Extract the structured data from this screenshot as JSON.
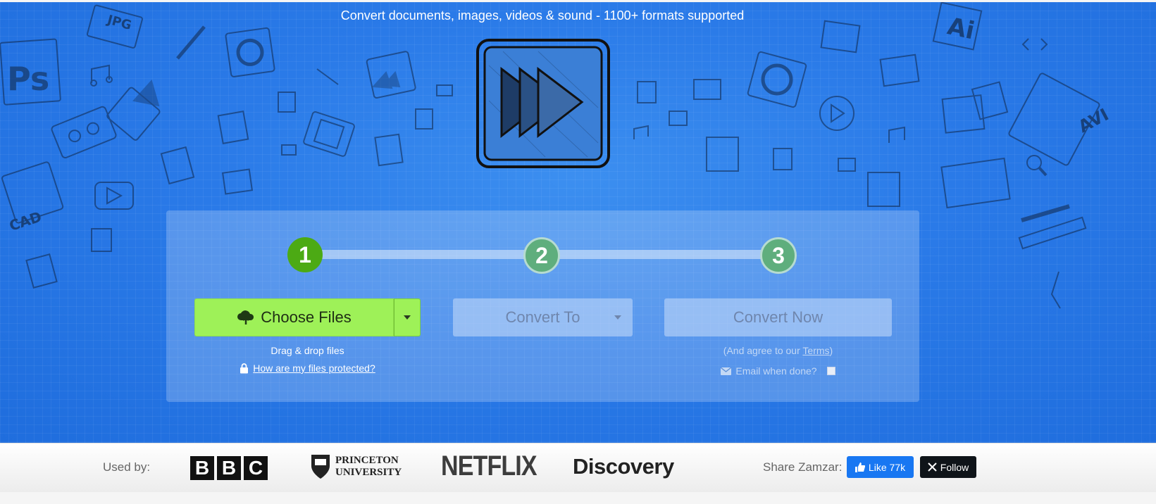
{
  "hero": {
    "tagline": "Convert documents, images, videos & sound - 1100+ formats supported"
  },
  "steps": [
    "1",
    "2",
    "3"
  ],
  "choose": {
    "label": "Choose Files",
    "drag_text": "Drag & drop files",
    "protect_link": "How are my files protected?"
  },
  "convert_to": {
    "label": "Convert To"
  },
  "convert_now": {
    "label": "Convert Now",
    "agree_prefix": "(And agree to our ",
    "terms_link": "Terms",
    "agree_suffix": ")",
    "email_label": "Email when done?"
  },
  "footer": {
    "used_by": "Used by:",
    "logos": {
      "bbc": [
        "B",
        "B",
        "C"
      ],
      "princeton_line1": "PRINCETON",
      "princeton_line2": "UNIVERSITY",
      "netflix": "NETFLIX",
      "discovery": "Discovery"
    },
    "share_label": "Share Zamzar:",
    "like_label": "Like 77k",
    "follow_label": "Follow"
  },
  "decor_labels": {
    "jpg": "JPG",
    "ps": "Ps",
    "ai": "Ai",
    "avi": "AVI",
    "cad": "CAD"
  },
  "colors": {
    "hero_blue": "#2a7ae8",
    "step_active": "#4caa14",
    "step_inactive": "#5fae7d",
    "choose_green": "#9ef158",
    "facebook_blue": "#1877f2",
    "x_black": "#0f1419"
  }
}
